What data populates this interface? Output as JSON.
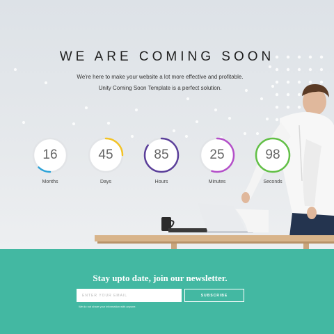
{
  "hero": {
    "title": "WE ARE COMING SOON",
    "subtitle_line1": "We're here to make your website a lot more effective and profitable.",
    "subtitle_line2": "Unity Coming Soon Template is a perfect solution."
  },
  "countdown": [
    {
      "value": "16",
      "label": "Months",
      "color": "#2da3d8",
      "progress": 0.12
    },
    {
      "value": "45",
      "label": "Days",
      "color": "#f3c326",
      "progress": 0.25
    },
    {
      "value": "85",
      "label": "Hours",
      "color": "#5b3f9a",
      "progress": 0.85
    },
    {
      "value": "25",
      "label": "Minutes",
      "color": "#b44fc9",
      "progress": 0.55
    },
    {
      "value": "98",
      "label": "Seconds",
      "color": "#62c046",
      "progress": 1.0
    }
  ],
  "newsletter": {
    "title": "Stay upto date, join our newsletter.",
    "email_placeholder": "ENTER YOUR EMAIL",
    "subscribe_label": "SUBSCRIBE",
    "note": "We do not share your information with anyone."
  },
  "colors": {
    "footer_bg": "#43b8a2",
    "ring_track": "#e2e4e7"
  }
}
